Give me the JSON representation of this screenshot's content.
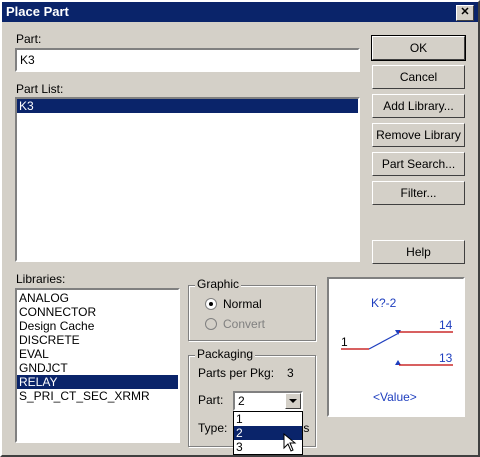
{
  "window": {
    "title": "Place Part",
    "close_glyph": "✕"
  },
  "part": {
    "label": "Part:",
    "value": "K3"
  },
  "part_list": {
    "label": "Part List:",
    "items": [
      "K3"
    ]
  },
  "buttons": {
    "ok": "OK",
    "cancel": "Cancel",
    "add_library": "Add Library...",
    "remove_library": "Remove Library",
    "part_search": "Part Search...",
    "filter": "Filter...",
    "help": "Help"
  },
  "libraries": {
    "label": "Libraries:",
    "items": [
      "ANALOG",
      "CONNECTOR",
      "Design Cache",
      "DISCRETE",
      "EVAL",
      "GNDJCT",
      "RELAY",
      "S_PRI_CT_SEC_XRMR"
    ],
    "selected": "RELAY"
  },
  "graphic": {
    "title": "Graphic",
    "normal": "Normal",
    "convert": "Convert"
  },
  "packaging": {
    "title": "Packaging",
    "parts_per_pkg_label": "Parts per Pkg:",
    "parts_per_pkg_value": "3",
    "part_label": "Part:",
    "part_value": "2",
    "type_label": "Type:",
    "type_value_tail": "ıs",
    "dropdown_options": [
      "1",
      "2",
      "3"
    ],
    "dropdown_selected": "2"
  },
  "preview": {
    "ref": "K?-2",
    "pin1": "1",
    "pin14": "14",
    "pin13": "13",
    "value": "<Value>",
    "colors": {
      "text": "#1f3fbf",
      "wire": "#c00000"
    }
  }
}
